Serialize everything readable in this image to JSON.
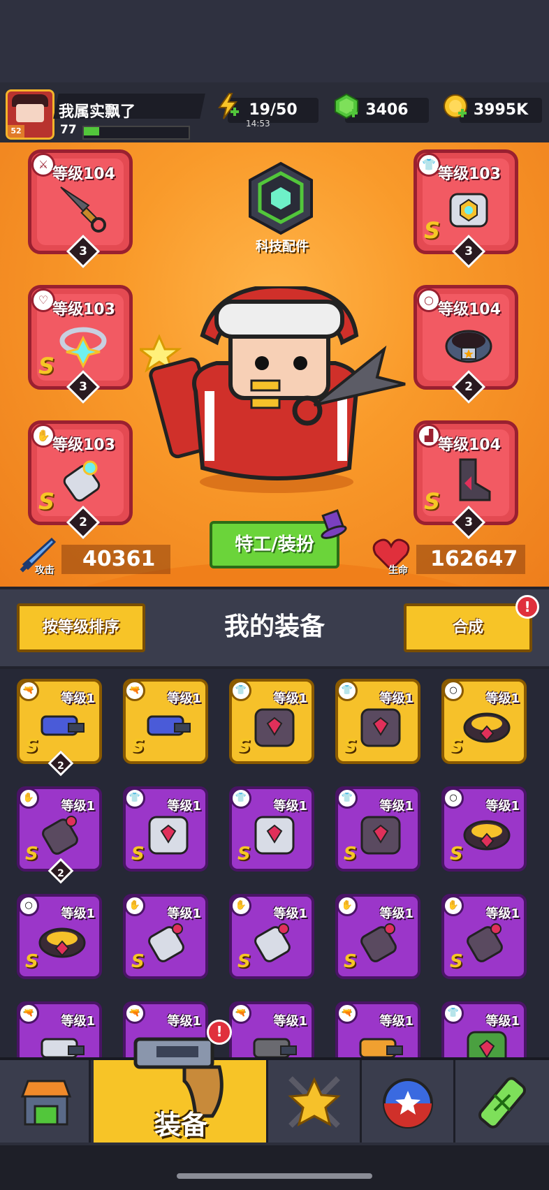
{
  "player": {
    "name": "我属实飘了",
    "level": "77",
    "badge": "52"
  },
  "resources": {
    "energy": "19/50",
    "energy_timer": "14:53",
    "gems": "3406",
    "coins": "3995K"
  },
  "tech": {
    "label": "科技配件"
  },
  "slots": [
    {
      "label": "等级104",
      "stars": "3",
      "icon": "weapon-icon",
      "rank": ""
    },
    {
      "label": "等级103",
      "stars": "3",
      "icon": "armor-icon",
      "rank": "S"
    },
    {
      "label": "等级103",
      "stars": "3",
      "icon": "necklace-icon",
      "rank": "S"
    },
    {
      "label": "等级104",
      "stars": "2",
      "icon": "belt-icon",
      "rank": ""
    },
    {
      "label": "等级103",
      "stars": "2",
      "icon": "glove-icon",
      "rank": "S"
    },
    {
      "label": "等级104",
      "stars": "3",
      "icon": "boot-icon",
      "rank": "S"
    }
  ],
  "stats": {
    "attack_label": "攻击",
    "attack": "40361",
    "hp_label": "生命",
    "hp": "162647"
  },
  "agent_button": "特工/装扮",
  "equipment": {
    "title": "我的装备",
    "sort_button": "按等级排序",
    "merge_button": "合成",
    "alert": "!"
  },
  "grid": [
    {
      "rarity": "gold",
      "label": "等级1",
      "type": "weapon-icon",
      "rank": "S",
      "dup": "2",
      "color": "#4a5bd8"
    },
    {
      "rarity": "gold",
      "label": "等级1",
      "type": "weapon-icon",
      "rank": "S",
      "dup": "",
      "color": "#4a5bd8"
    },
    {
      "rarity": "gold",
      "label": "等级1",
      "type": "armor-icon",
      "rank": "S",
      "dup": "",
      "color": "#5a4a60"
    },
    {
      "rarity": "gold",
      "label": "等级1",
      "type": "armor-icon",
      "rank": "S",
      "dup": "",
      "color": "#5a4a60"
    },
    {
      "rarity": "gold",
      "label": "等级1",
      "type": "belt-icon",
      "rank": "S",
      "dup": "",
      "color": "#3a2a36"
    },
    {
      "rarity": "purple",
      "label": "等级1",
      "type": "glove-icon",
      "rank": "S",
      "dup": "2",
      "color": "#5a4a60"
    },
    {
      "rarity": "purple",
      "label": "等级1",
      "type": "armor-icon",
      "rank": "S",
      "dup": "",
      "color": "#d8dce6"
    },
    {
      "rarity": "purple",
      "label": "等级1",
      "type": "armor-icon",
      "rank": "S",
      "dup": "",
      "color": "#d8dce6"
    },
    {
      "rarity": "purple",
      "label": "等级1",
      "type": "armor-icon",
      "rank": "S",
      "dup": "",
      "color": "#5a4a60"
    },
    {
      "rarity": "purple",
      "label": "等级1",
      "type": "belt-icon",
      "rank": "S",
      "dup": "",
      "color": "#3a2a36"
    },
    {
      "rarity": "purple",
      "label": "等级1",
      "type": "belt-icon",
      "rank": "S",
      "dup": "",
      "color": "#3a2a36"
    },
    {
      "rarity": "purple",
      "label": "等级1",
      "type": "glove-icon",
      "rank": "S",
      "dup": "",
      "color": "#d8dce6"
    },
    {
      "rarity": "purple",
      "label": "等级1",
      "type": "glove-icon",
      "rank": "S",
      "dup": "",
      "color": "#d8dce6"
    },
    {
      "rarity": "purple",
      "label": "等级1",
      "type": "glove-icon",
      "rank": "S",
      "dup": "",
      "color": "#5a4a60"
    },
    {
      "rarity": "purple",
      "label": "等级1",
      "type": "glove-icon",
      "rank": "S",
      "dup": "",
      "color": "#5a4a60"
    },
    {
      "rarity": "purple",
      "label": "等级1",
      "type": "weapon-icon",
      "rank": "",
      "dup": "",
      "color": "#d8dce6"
    },
    {
      "rarity": "purple",
      "label": "等级1",
      "type": "weapon-icon",
      "rank": "",
      "dup": "",
      "color": "#6a6a70"
    },
    {
      "rarity": "purple",
      "label": "等级1",
      "type": "weapon-icon",
      "rank": "",
      "dup": "",
      "color": "#6a6a70"
    },
    {
      "rarity": "purple",
      "label": "等级1",
      "type": "weapon-icon",
      "rank": "",
      "dup": "",
      "color": "#f0a030"
    },
    {
      "rarity": "purple",
      "label": "等级1",
      "type": "armor-icon",
      "rank": "",
      "dup": "",
      "color": "#4aa040"
    }
  ],
  "nav": {
    "active_label": "装备",
    "alert": "!",
    "tabs": [
      "shop-icon",
      "equipment-icon",
      "star-icon",
      "orb-icon",
      "dna-icon"
    ]
  }
}
